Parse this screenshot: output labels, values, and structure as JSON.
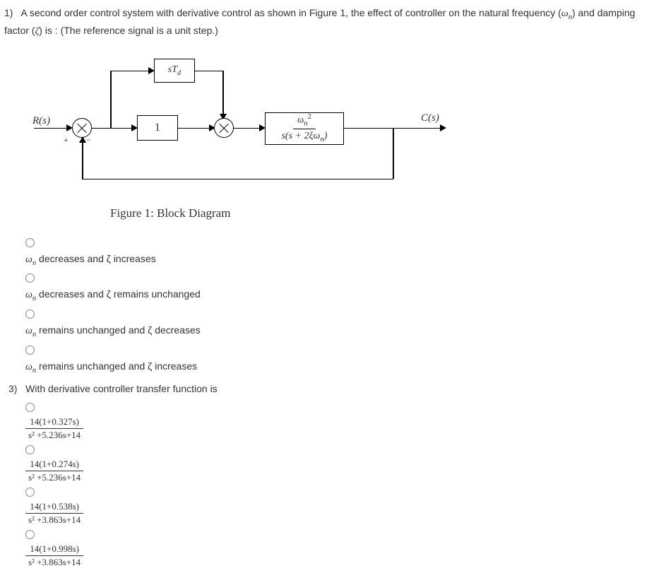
{
  "q1": {
    "number": "1)",
    "text_part1": "A second order control system with derivative control as shown in Figure 1, the effect of controller on the natural frequency (",
    "text_wn": "ω",
    "text_wn_sub": "n",
    "text_part2": ") and damping factor (",
    "text_zeta": "ζ",
    "text_part3": ") is : (The reference signal is a unit step.)"
  },
  "diagram": {
    "Rs": "R(s)",
    "Cs": "C(s)",
    "std": "sT",
    "std_sub": "d",
    "gain1": "1",
    "plant_num": "ω",
    "plant_den": "s(s + 2ξω",
    "plant_den_sub": "n",
    "plant_den_end": ")",
    "caption": "Figure 1: Block Diagram",
    "plus": "+",
    "minus": "−"
  },
  "q1_options": {
    "a_wn": "ω",
    "a_sub": "n",
    "a_text": " decreases and ζ increases",
    "b_wn": "ω",
    "b_sub": "n",
    "b_text": " decreases and ζ remains unchanged",
    "c_wn": "ω",
    "c_sub": "n",
    "c_text": " remains unchanged and ζ decreases",
    "d_wn": "ω",
    "d_sub": "n",
    "d_text": " remains unchanged and ζ increases"
  },
  "q3": {
    "number": "3)",
    "text": "With derivative controller transfer function is"
  },
  "q3_options": {
    "a_num": "14(1+0.327s)",
    "a_den": "s² +5.236s+14",
    "b_num": "14(1+0.274s)",
    "b_den": "s² +5.236s+14",
    "c_num": "14(1+0.538s)",
    "c_den": "s² +3.863s+14",
    "d_num": "14(1+0.998s)",
    "d_den": "s² +3.863s+14"
  }
}
